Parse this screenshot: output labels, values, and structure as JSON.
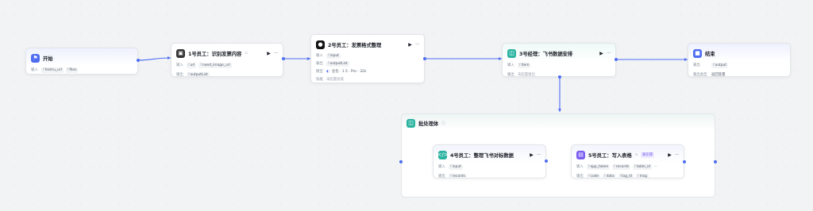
{
  "labels": {
    "in": "输入",
    "out": "输出",
    "model": "模型",
    "skill": "技能",
    "out_type": "输出类型",
    "type_prefix": "f"
  },
  "start": {
    "title": "开始",
    "inputs": [
      "feishu_url",
      "files"
    ]
  },
  "node1": {
    "title": "1号员工：识别发票内容",
    "inputs": [
      "url",
      "need_image_url"
    ],
    "outputs": [
      "outputList"
    ]
  },
  "node2": {
    "title": "2号员工：发票格式整理",
    "inputs": [
      "input"
    ],
    "outputs": [
      "outputList"
    ],
    "model": "豆包 · 1.5 · Pro · 32k",
    "skill": "未配置技能"
  },
  "node3": {
    "title": "3号经理：飞书数据安排",
    "inputs": [
      "item"
    ],
    "outputs": "未配置输出"
  },
  "end": {
    "title": "结束",
    "outputs": [
      "output"
    ],
    "out_type": "返回变量"
  },
  "group": {
    "title": "批处理体",
    "info": "ⓘ"
  },
  "node4": {
    "title": "4号员工：整理飞书对标数据",
    "inputs": [
      "input"
    ],
    "outputs": [
      "records"
    ]
  },
  "node5": {
    "title": "5号员工：写入表格",
    "badge": "知识库",
    "inputs": [
      "app_token",
      "records",
      "table_id"
    ],
    "outputs": [
      "code",
      "data",
      "log_id",
      "msg"
    ]
  },
  "controls": {
    "play": "▶",
    "more": "···"
  },
  "colors": {
    "edge": "#4e6ef2",
    "accent": "#4e6ef2"
  },
  "icons": {
    "start": "flag-icon",
    "node1": "image-icon",
    "node2": "llm-icon",
    "node3": "manager-icon",
    "end": "end-icon",
    "node4": "code-icon",
    "node5": "plugin-icon"
  }
}
